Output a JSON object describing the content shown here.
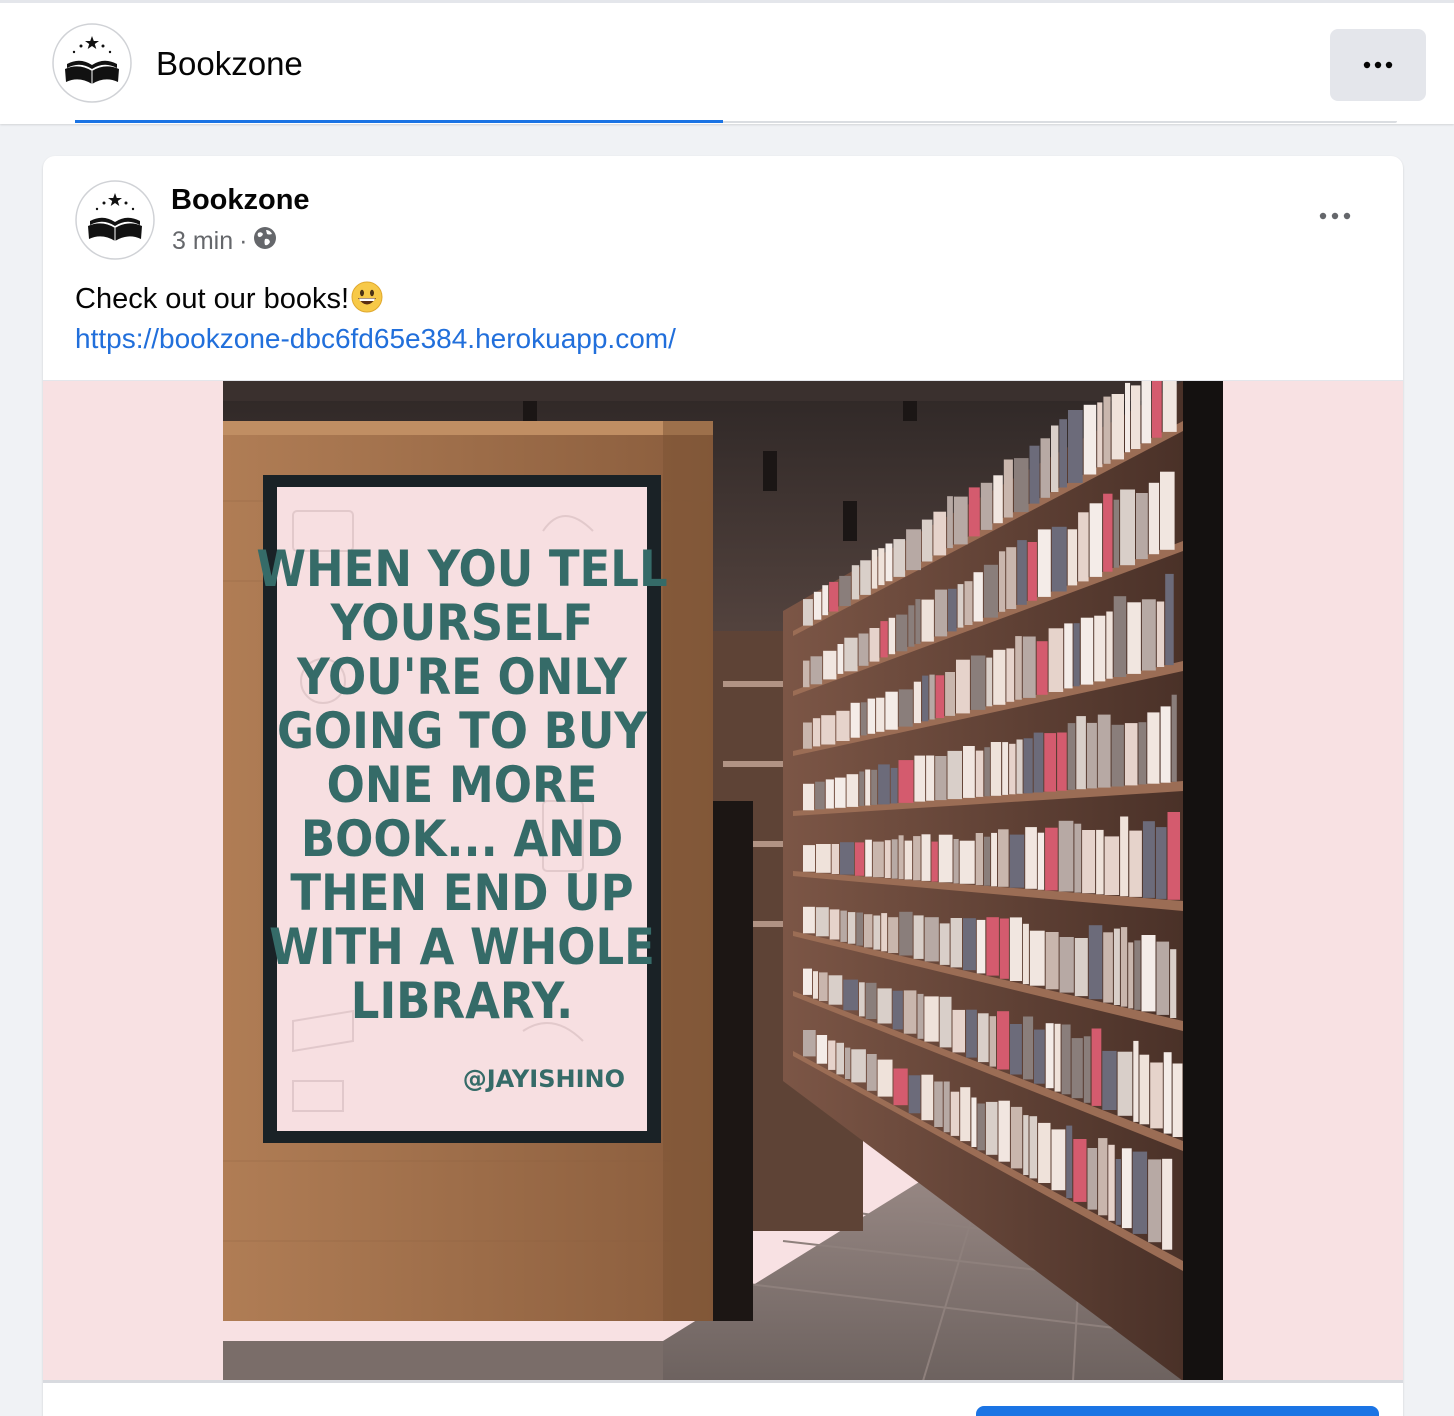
{
  "header": {
    "page_name": "Bookzone",
    "more_icon": "more-horizontal-icon"
  },
  "post": {
    "author": "Bookzone",
    "time": "3 min",
    "separator": "·",
    "privacy_icon": "globe-icon",
    "text": "Check out our books!",
    "emoji": "grinning-face",
    "link": "https://bookzone-dbc6fd65e384.herokuapp.com/",
    "menu_icon": "more-horizontal-icon",
    "image": {
      "quote_lines": [
        "WHEN YOU TELL",
        "YOURSELF",
        "YOU'RE ONLY",
        "GOING TO BUY",
        "ONE MORE",
        "BOOK... AND",
        "THEN END UP",
        "WITH A WHOLE",
        "LIBRARY."
      ],
      "credit": "@JAYISHINO"
    }
  },
  "colors": {
    "brand_blue": "#1b74e4",
    "link_blue": "#216fdb",
    "secondary_text": "#65676b",
    "poster_bg": "#f7dfe1",
    "quote_text": "#356b68",
    "media_bg": "#f8e1e3"
  }
}
